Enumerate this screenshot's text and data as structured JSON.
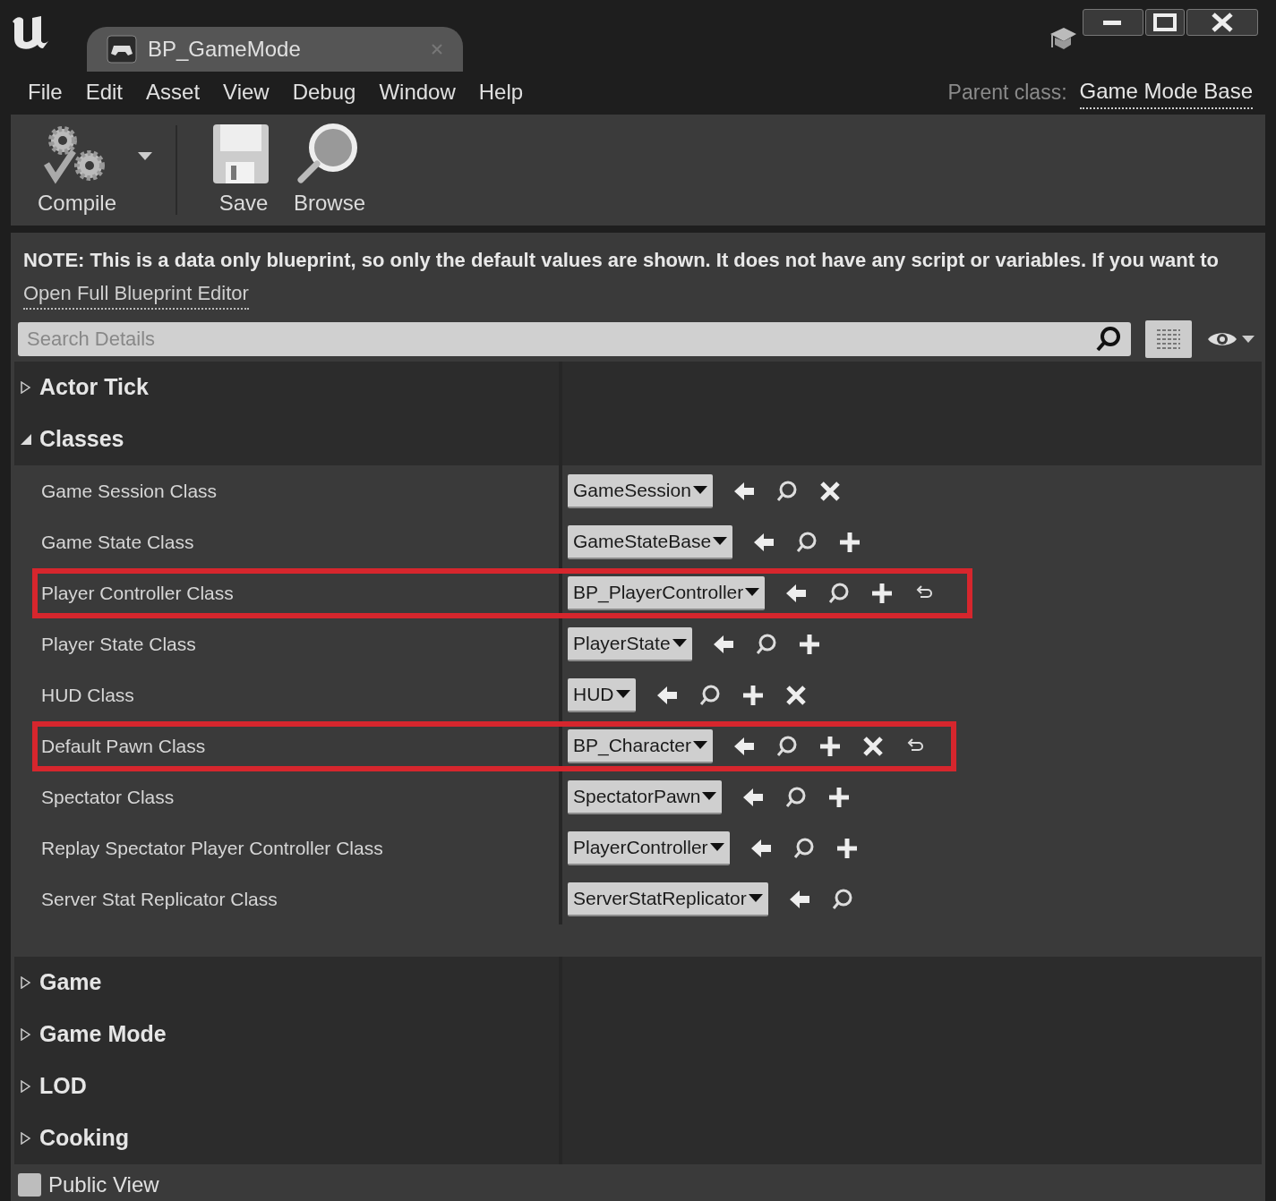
{
  "tab": {
    "title": "BP_GameMode"
  },
  "menu": [
    "File",
    "Edit",
    "Asset",
    "View",
    "Debug",
    "Window",
    "Help"
  ],
  "parent_class": {
    "label": "Parent class:",
    "value": "Game Mode Base"
  },
  "toolbar": [
    {
      "label": "Compile",
      "kind": "compile",
      "dropdown": true
    },
    {
      "label": "Save",
      "kind": "save",
      "dropdown": false
    },
    {
      "label": "Browse",
      "kind": "browse",
      "dropdown": false
    }
  ],
  "note": {
    "text": "NOTE: This is a data only blueprint, so only the default values are shown.  It does not have any script or variables.  If you want to",
    "link": "Open Full Blueprint Editor"
  },
  "search": {
    "placeholder": "Search Details"
  },
  "categories": [
    {
      "title": "Actor Tick",
      "expanded": false
    },
    {
      "title": "Classes",
      "expanded": true,
      "rows": [
        {
          "label": "Game Session Class",
          "value": "GameSession",
          "actions": [
            {
              "kind": "use"
            },
            {
              "kind": "browse"
            },
            {
              "kind": "clear"
            }
          ],
          "highlighted": false
        },
        {
          "label": "Game State Class",
          "value": "GameStateBase",
          "actions": [
            {
              "kind": "use"
            },
            {
              "kind": "browse"
            },
            {
              "kind": "new"
            }
          ],
          "highlighted": false
        },
        {
          "label": "Player Controller Class",
          "value": "BP_PlayerController",
          "actions": [
            {
              "kind": "use"
            },
            {
              "kind": "browse"
            },
            {
              "kind": "new"
            },
            {
              "kind": "reset"
            }
          ],
          "highlighted": true
        },
        {
          "label": "Player State Class",
          "value": "PlayerState",
          "actions": [
            {
              "kind": "use"
            },
            {
              "kind": "browse"
            },
            {
              "kind": "new"
            }
          ],
          "highlighted": false
        },
        {
          "label": "HUD Class",
          "value": "HUD",
          "actions": [
            {
              "kind": "use"
            },
            {
              "kind": "browse"
            },
            {
              "kind": "new"
            },
            {
              "kind": "clear"
            }
          ],
          "highlighted": false
        },
        {
          "label": "Default Pawn Class",
          "value": "BP_Character",
          "actions": [
            {
              "kind": "use"
            },
            {
              "kind": "browse"
            },
            {
              "kind": "new"
            },
            {
              "kind": "clear"
            },
            {
              "kind": "reset"
            }
          ],
          "highlighted": true
        },
        {
          "label": "Spectator Class",
          "value": "SpectatorPawn",
          "actions": [
            {
              "kind": "use"
            },
            {
              "kind": "browse"
            },
            {
              "kind": "new"
            }
          ],
          "highlighted": false
        },
        {
          "label": "Replay Spectator Player Controller Class",
          "value": "PlayerController",
          "actions": [
            {
              "kind": "use"
            },
            {
              "kind": "browse"
            },
            {
              "kind": "new"
            }
          ],
          "highlighted": false
        },
        {
          "label": "Server Stat Replicator Class",
          "value": "ServerStatReplicator",
          "actions": [
            {
              "kind": "use"
            },
            {
              "kind": "browse"
            }
          ],
          "highlighted": false
        }
      ]
    },
    {
      "title": "Game",
      "expanded": false
    },
    {
      "title": "Game Mode",
      "expanded": false
    },
    {
      "title": "LOD",
      "expanded": false
    },
    {
      "title": "Cooking",
      "expanded": false
    }
  ],
  "public_view": {
    "label": "Public View",
    "checked": false
  }
}
